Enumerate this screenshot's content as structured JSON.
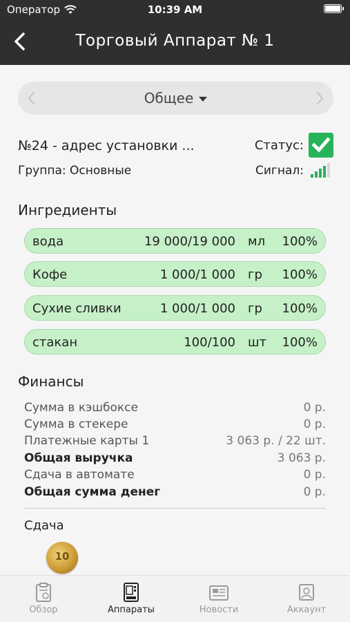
{
  "status_bar": {
    "carrier": "Оператор",
    "time": "10:39 AM"
  },
  "header": {
    "title": "Торговый Аппарат № 1"
  },
  "segment": {
    "label": "Общее"
  },
  "machine": {
    "address": "№24 - адрес установки ...",
    "status_label": "Статус:",
    "group": "Группа: Основные",
    "signal_label": "Сигнал:",
    "signal_level": 4
  },
  "ingredients": {
    "title": "Ингредиенты",
    "items": [
      {
        "name": "вода",
        "amount": "19 000/19 000",
        "unit": "мл",
        "percent": "100%"
      },
      {
        "name": "Кофе",
        "amount": "1 000/1 000",
        "unit": "гр",
        "percent": "100%"
      },
      {
        "name": "Сухие сливки",
        "amount": "1 000/1 000",
        "unit": "гр",
        "percent": "100%"
      },
      {
        "name": "стакан",
        "amount": "100/100",
        "unit": "шт",
        "percent": "100%"
      }
    ]
  },
  "finance": {
    "title": "Финансы",
    "rows": [
      {
        "label": "Сумма в кэшбоксе",
        "value": "0 р."
      },
      {
        "label": "Сумма в стекере",
        "value": "0 р."
      },
      {
        "label": "Платежные карты 1",
        "value": "3 063 р. / 22 шт."
      },
      {
        "label": "Общая выручка",
        "value": "3 063 р."
      },
      {
        "label": "Сдача в автомате",
        "value": "0 р."
      },
      {
        "label": "Общая сумма денег",
        "value": "0 р."
      }
    ]
  },
  "change": {
    "title": "Сдача",
    "coin_label": "10"
  },
  "tabs": [
    {
      "label": "Обзор",
      "icon": "clipboard-icon"
    },
    {
      "label": "Аппараты",
      "icon": "vending-machine-icon"
    },
    {
      "label": "Новости",
      "icon": "newspaper-icon"
    },
    {
      "label": "Аккаунт",
      "icon": "account-icon"
    }
  ],
  "colors": {
    "header_bg": "#2f2f2f",
    "ingredient_bg": "#c6f0c8",
    "status_ok": "#27b35a",
    "signal": "#27b35a"
  }
}
